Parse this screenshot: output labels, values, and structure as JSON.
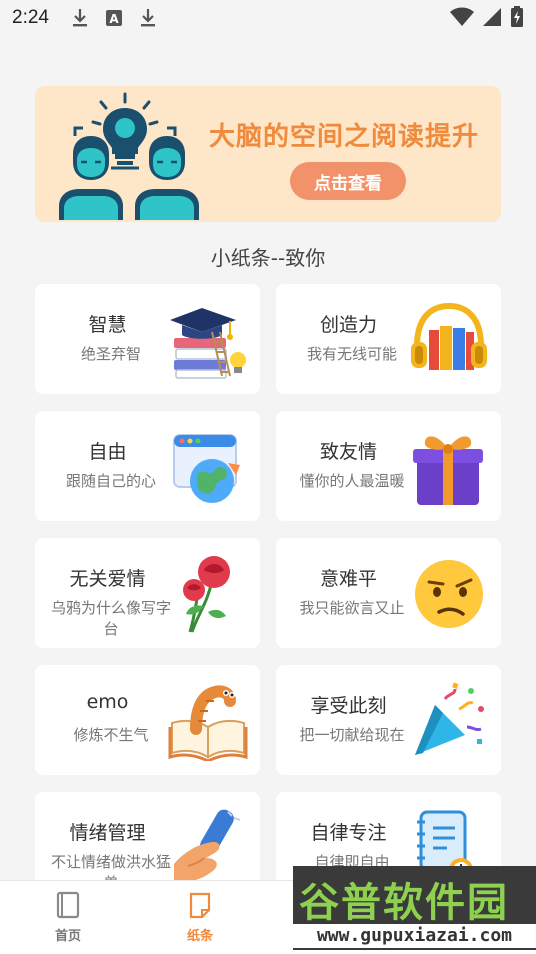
{
  "status_bar": {
    "time": "2:24",
    "left_icons": [
      "download-icon",
      "a-badge-icon",
      "download-icon"
    ],
    "right_icons": [
      "wifi-icon",
      "signal-icon",
      "battery-icon"
    ]
  },
  "banner": {
    "title": "大脑的空间之阅读提升",
    "button_label": "点击查看",
    "icon": "people-lightbulb-illustration"
  },
  "section_title": "小纸条--致你",
  "cards": [
    {
      "title": "智慧",
      "subtitle": "绝圣弃智",
      "icon": "graduation-books-icon"
    },
    {
      "title": "创造力",
      "subtitle": "我有无线可能",
      "icon": "headphones-books-icon"
    },
    {
      "title": "自由",
      "subtitle": "跟随自己的心",
      "icon": "globe-browser-icon"
    },
    {
      "title": "致友情",
      "subtitle": "懂你的人最温暖",
      "icon": "gift-box-icon"
    },
    {
      "title": "无关爱情",
      "subtitle": "乌鸦为什么像写字台",
      "icon": "rose-icon"
    },
    {
      "title": "意难平",
      "subtitle": "我只能欲言又止",
      "icon": "confused-emoji-icon"
    },
    {
      "title": "emo",
      "subtitle": "修炼不生气",
      "icon": "worm-book-icon"
    },
    {
      "title": "享受此刻",
      "subtitle": "把一切献给现在",
      "icon": "party-popper-icon"
    },
    {
      "title": "情绪管理",
      "subtitle": "不让情绪做洪水猛兽",
      "icon": "hand-scroll-icon"
    },
    {
      "title": "自律专注",
      "subtitle": "自律即自由",
      "icon": "notebook-clock-icon"
    }
  ],
  "bottom_nav": [
    {
      "label": "首页",
      "icon": "book-icon",
      "active": false
    },
    {
      "label": "纸条",
      "icon": "note-icon",
      "active": true
    }
  ],
  "watermark": {
    "title": "谷普软件园",
    "url": "www.gupuxiazai.com"
  },
  "colors": {
    "accent": "#f08a3c",
    "banner_bg": "#fde7c8",
    "button_bg": "#f1926b",
    "nav_inactive": "#888888"
  }
}
